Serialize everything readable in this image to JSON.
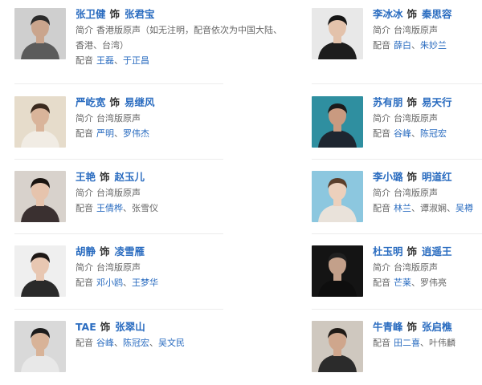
{
  "labels": {
    "shi": "饰",
    "intro": "简介",
    "dub": "配音",
    "sep": "、"
  },
  "cast": [
    {
      "actor": "张卫健",
      "role": "张君宝",
      "intro_line1": "香港版原声（如无注明，配音依次为中国大陆、",
      "intro_line2": "香港、台湾）",
      "dub": [
        {
          "name": "王磊",
          "link": true
        },
        {
          "name": "于正昌",
          "link": true
        }
      ],
      "photo": {
        "bg": "#cfcfcf",
        "skin": "#caa58d",
        "hair": "#2b2b2b",
        "cloth": "#5b5b5b"
      }
    },
    {
      "actor": "李冰冰",
      "role": "秦思容",
      "intro_line1": "台湾版原声",
      "intro_line2": "",
      "dub": [
        {
          "name": "薛白",
          "link": true
        },
        {
          "name": "朱妙兰",
          "link": true
        }
      ],
      "photo": {
        "bg": "#e8e8e8",
        "skin": "#e3c2ab",
        "hair": "#151515",
        "cloth": "#1d1d1d"
      }
    },
    {
      "actor": "严屹宽",
      "role": "易继风",
      "intro_line1": "台湾版原声",
      "intro_line2": "",
      "dub": [
        {
          "name": "严明",
          "link": true
        },
        {
          "name": "罗伟杰",
          "link": true
        }
      ],
      "photo": {
        "bg": "#e6dccb",
        "skin": "#d9b49a",
        "hair": "#3a2a1e",
        "cloth": "#f1ece4"
      }
    },
    {
      "actor": "苏有朋",
      "role": "易天行",
      "intro_line1": "台湾版原声",
      "intro_line2": "",
      "dub": [
        {
          "name": "谷峰",
          "link": true
        },
        {
          "name": "陈冠宏",
          "link": true
        }
      ],
      "photo": {
        "bg": "#2f8fa0",
        "skin": "#c99a80",
        "hair": "#1b1b1b",
        "cloth": "#1e2630"
      }
    },
    {
      "actor": "王艳",
      "role": "赵玉儿",
      "intro_line1": "台湾版原声",
      "intro_line2": "",
      "dub": [
        {
          "name": "王倩桦",
          "link": true
        },
        {
          "name": "张雪仪",
          "link": false
        }
      ],
      "photo": {
        "bg": "#d8d2cc",
        "skin": "#e6c4ad",
        "hair": "#1a1410",
        "cloth": "#3a3030"
      }
    },
    {
      "actor": "李小璐",
      "role": "明道红",
      "intro_line1": "台湾版原声",
      "intro_line2": "",
      "dub": [
        {
          "name": "林兰",
          "link": true
        },
        {
          "name": "谭淑娴",
          "link": false
        },
        {
          "name": "吴樽",
          "link": true
        }
      ],
      "photo": {
        "bg": "#8cc7df",
        "skin": "#ecd0bc",
        "hair": "#5a3e2b",
        "cloth": "#e9e2da"
      }
    },
    {
      "actor": "胡静",
      "role": "凌雪雁",
      "intro_line1": "台湾版原声",
      "intro_line2": "",
      "dub": [
        {
          "name": "邓小鸥",
          "link": true
        },
        {
          "name": "王梦华",
          "link": true
        }
      ],
      "photo": {
        "bg": "#efefef",
        "skin": "#e8c7b2",
        "hair": "#1e1816",
        "cloth": "#2a2a2a"
      }
    },
    {
      "actor": "杜玉明",
      "role": "逍遥王",
      "intro_line1": "台湾版原声",
      "intro_line2": "",
      "dub": [
        {
          "name": "芒莱",
          "link": true
        },
        {
          "name": "罗伟亮",
          "link": false
        }
      ],
      "photo": {
        "bg": "#141414",
        "skin": "#c3a08a",
        "hair": "#202020",
        "cloth": "#0e0e0e"
      }
    },
    {
      "actor": "TAE",
      "role": "张翠山",
      "intro_line1": "",
      "intro_line2": "",
      "dub": [
        {
          "name": "谷峰",
          "link": true
        },
        {
          "name": "陈冠宏",
          "link": true
        },
        {
          "name": "吴文民",
          "link": true
        }
      ],
      "photo": {
        "bg": "#d9d9d9",
        "skin": "#d8b398",
        "hair": "#1c1c1c",
        "cloth": "#e8e8e8"
      }
    },
    {
      "actor": "牛青峰",
      "role": "张启樵",
      "intro_line1": "",
      "intro_line2": "",
      "dub": [
        {
          "name": "田二喜",
          "link": true
        },
        {
          "name": "叶伟麟",
          "link": false
        }
      ],
      "photo": {
        "bg": "#cfc8bf",
        "skin": "#cfa68c",
        "hair": "#1f1a16",
        "cloth": "#2b2b2b"
      }
    }
  ]
}
